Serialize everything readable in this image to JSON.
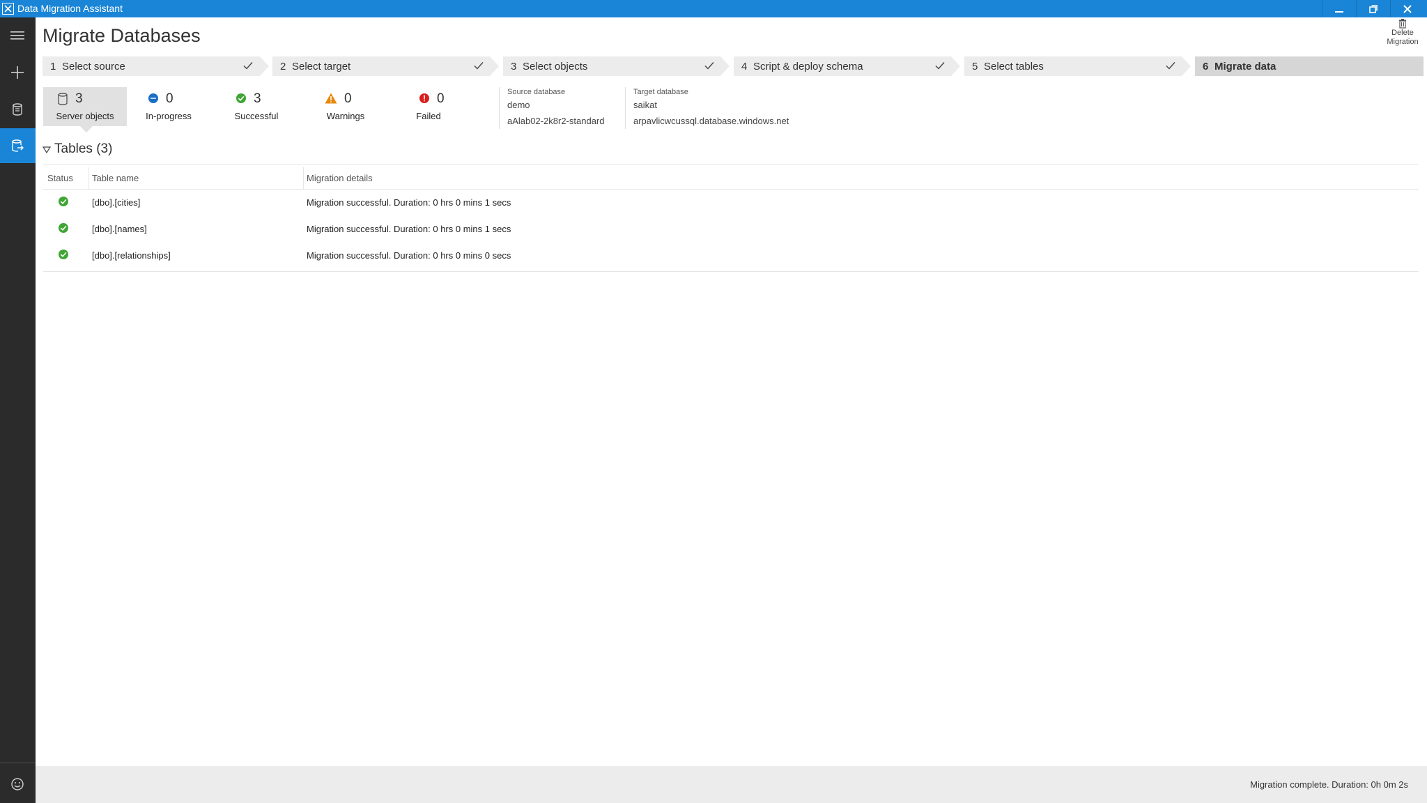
{
  "window": {
    "title": "Data Migration Assistant",
    "accent_color": "#1a85d6",
    "rail_color": "#2b2b2b"
  },
  "rail": {
    "items": [
      {
        "name": "hamburger-menu-icon"
      },
      {
        "name": "new-project-icon"
      },
      {
        "name": "assessment-icon"
      },
      {
        "name": "migration-icon"
      },
      {
        "name": "feedback-smiley-icon"
      }
    ]
  },
  "header": {
    "title": "Migrate Databases",
    "delete_line1": "Delete",
    "delete_line2": "Migration"
  },
  "steps": [
    {
      "num": "1",
      "label": "Select source",
      "completed": true
    },
    {
      "num": "2",
      "label": "Select target",
      "completed": true
    },
    {
      "num": "3",
      "label": "Select objects",
      "completed": true
    },
    {
      "num": "4",
      "label": "Script & deploy schema",
      "completed": true
    },
    {
      "num": "5",
      "label": "Select tables",
      "completed": true
    },
    {
      "num": "6",
      "label": "Migrate data",
      "completed": false,
      "active": true
    }
  ],
  "summary": {
    "server_objects": {
      "count": "3",
      "label": "Server objects"
    },
    "in_progress": {
      "count": "0",
      "label": "In-progress"
    },
    "successful": {
      "count": "3",
      "label": "Successful"
    },
    "warnings": {
      "count": "0",
      "label": "Warnings"
    },
    "failed": {
      "count": "0",
      "label": "Failed"
    }
  },
  "source_db": {
    "caption": "Source database",
    "name": "demo",
    "server": "aAlab02-2k8r2-standard"
  },
  "target_db": {
    "caption": "Target database",
    "name": "saikat",
    "server": "arpavlicwcussql.database.windows.net"
  },
  "tables": {
    "header": "Tables (3)",
    "columns": [
      "Status",
      "Table name",
      "Migration details"
    ],
    "rows": [
      {
        "status": "success",
        "name": "[dbo].[cities]",
        "details": "Migration successful. Duration: 0 hrs 0 mins 1 secs"
      },
      {
        "status": "success",
        "name": "[dbo].[names]",
        "details": "Migration successful. Duration: 0 hrs 0 mins 1 secs"
      },
      {
        "status": "success",
        "name": "[dbo].[relationships]",
        "details": "Migration successful. Duration: 0 hrs 0 mins 0 secs"
      }
    ]
  },
  "status_colors": {
    "success": "#3fa535",
    "in_progress": "#1a6fc4",
    "warning": "#e8870c",
    "failed": "#d81e1e"
  },
  "statusbar": {
    "text": "Migration complete. Duration:  0h 0m 2s"
  }
}
